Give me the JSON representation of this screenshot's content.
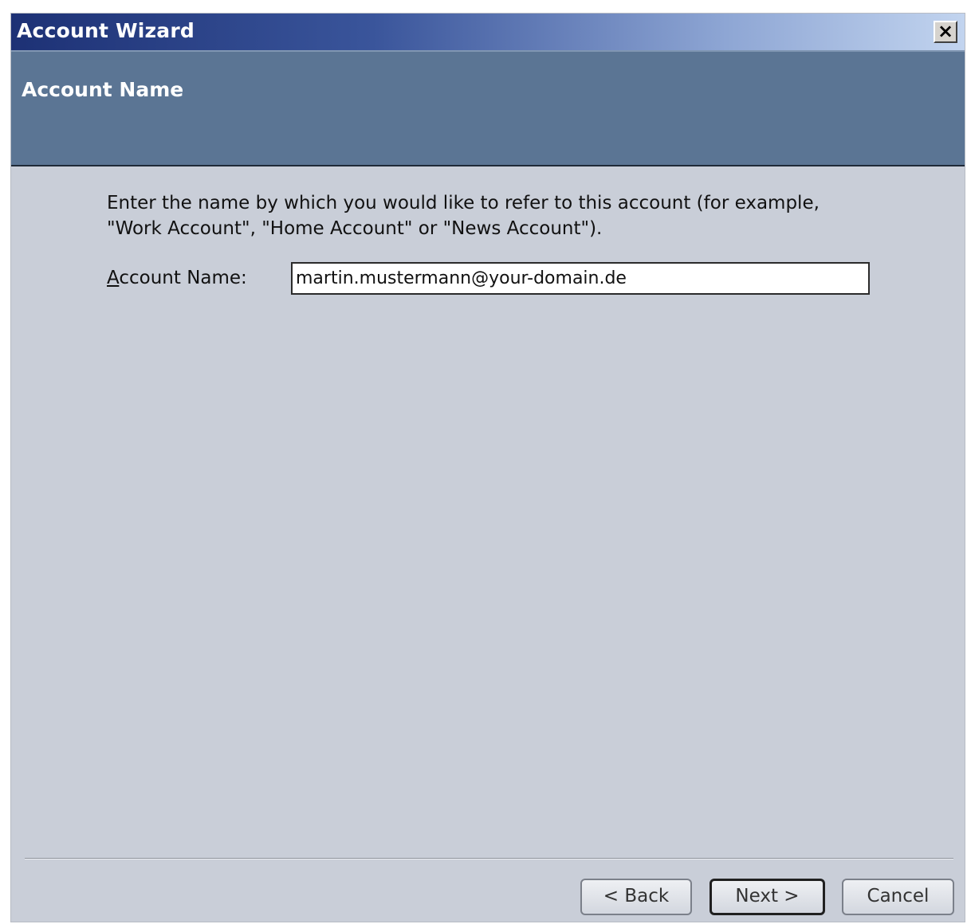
{
  "window": {
    "title": "Account Wizard",
    "close_label": "×"
  },
  "header": {
    "title": "Account Name"
  },
  "content": {
    "description": "Enter the name by which you would like to refer to this account (for example, \"Work Account\", \"Home Account\" or \"News Account\").",
    "field_label_accesskey": "A",
    "field_label_rest": "ccount Name:",
    "field_value": "martin.mustermann@your-domain.de"
  },
  "buttons": {
    "back": "< Back",
    "next": "Next >",
    "cancel": "Cancel"
  },
  "colors": {
    "titlebar_start": "#1d3175",
    "titlebar_end": "#c2d4ef",
    "header_banner": "#5b7594",
    "dialog_background": "#c9ced8"
  }
}
